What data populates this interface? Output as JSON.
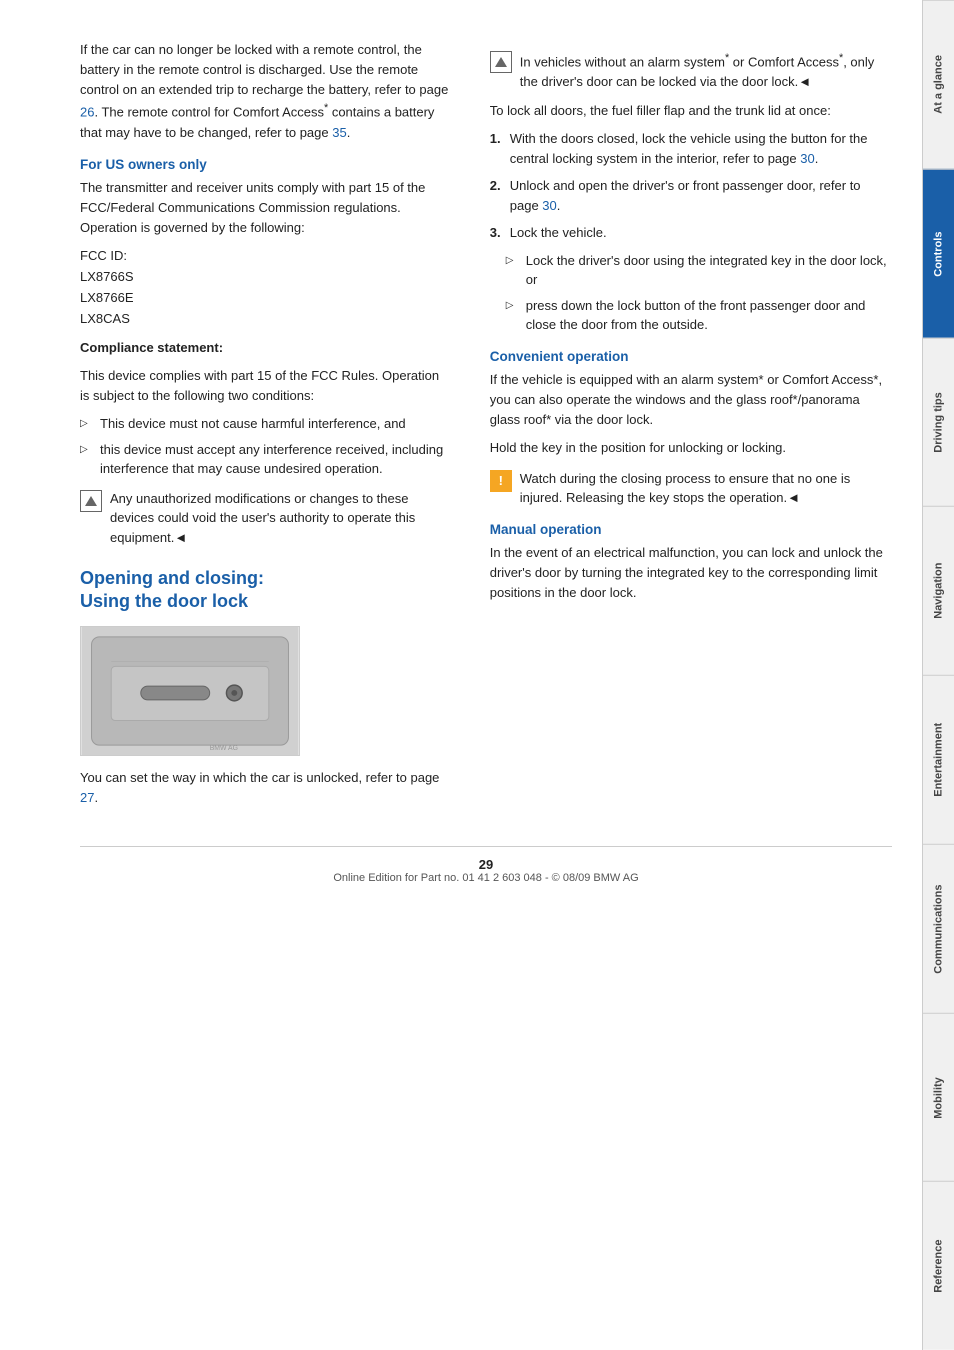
{
  "sidebar": {
    "tabs": [
      {
        "label": "At a glance",
        "active": false
      },
      {
        "label": "Controls",
        "active": true
      },
      {
        "label": "Driving tips",
        "active": false
      },
      {
        "label": "Navigation",
        "active": false
      },
      {
        "label": "Entertainment",
        "active": false
      },
      {
        "label": "Communications",
        "active": false
      },
      {
        "label": "Mobility",
        "active": false
      },
      {
        "label": "Reference",
        "active": false
      }
    ]
  },
  "left_col": {
    "intro_text": "If the car can no longer be locked with a remote control, the battery in the remote control is discharged. Use the remote control on an extended trip to recharge the battery, refer to page 26. The remote control for Comfort Access* contains a battery that may have to be changed, refer to page 35.",
    "page_26": "26",
    "page_35": "35",
    "for_us_heading": "For US owners only",
    "fcc_intro": "The transmitter and receiver units comply with part 15 of the FCC/Federal Communications Commission regulations. Operation is governed by the following:",
    "fcc_lines": [
      "FCC ID:",
      "LX8766S",
      "LX8766E",
      "LX8CAS"
    ],
    "compliance_heading": "Compliance statement:",
    "compliance_text": "This device complies with part 15 of the FCC Rules. Operation is subject to the following two conditions:",
    "conditions": [
      "This device must not cause harmful interference, and",
      "this device must accept any interference received, including interference that may cause undesired operation."
    ],
    "note_text": "Any unauthorized modifications or changes to these devices could void the user's authority to operate this equipment.",
    "note_end_arrow": "◄",
    "big_heading_line1": "Opening and closing:",
    "big_heading_line2": "Using the door lock",
    "image_caption": "You can set the way in which the car is unlocked, refer to page 27.",
    "page_27": "27"
  },
  "right_col": {
    "vehicles_note_text": "In vehicles without an alarm system* or Comfort Access*, only the driver's door can be locked via the door lock.",
    "vehicles_end_arrow": "◄",
    "lock_all_intro": "To lock all doors, the fuel filler flap and the trunk lid at once:",
    "steps": [
      {
        "num": "1.",
        "text": "With the doors closed, lock the vehicle using the button for the central locking system in the interior, refer to page 30."
      },
      {
        "num": "2.",
        "text": "Unlock and open the driver's or front passenger door, refer to page 30."
      },
      {
        "num": "3.",
        "text": "Lock the vehicle."
      }
    ],
    "page_30a": "30",
    "page_30b": "30",
    "sub_steps": [
      "Lock the driver's door using the integrated key in the door lock, or",
      "press down the lock button of the front passenger door and close the door from the outside."
    ],
    "convenient_heading": "Convenient operation",
    "convenient_text1": "If the vehicle is equipped with an alarm system* or Comfort Access*, you can also operate the windows and the glass roof*/panorama glass roof* via the door lock.",
    "convenient_text2": "Hold the key in the position for unlocking or locking.",
    "warning_text": "Watch during the closing process to ensure that no one is injured. Releasing the key stops the operation.",
    "warning_end_arrow": "◄",
    "manual_heading": "Manual operation",
    "manual_text": "In the event of an electrical malfunction, you can lock and unlock the driver's door by turning the integrated key to the corresponding limit positions in the door lock."
  },
  "footer": {
    "page_number": "29",
    "copyright": "Online Edition for Part no. 01 41 2 603 048 - © 08/09 BMW AG"
  }
}
